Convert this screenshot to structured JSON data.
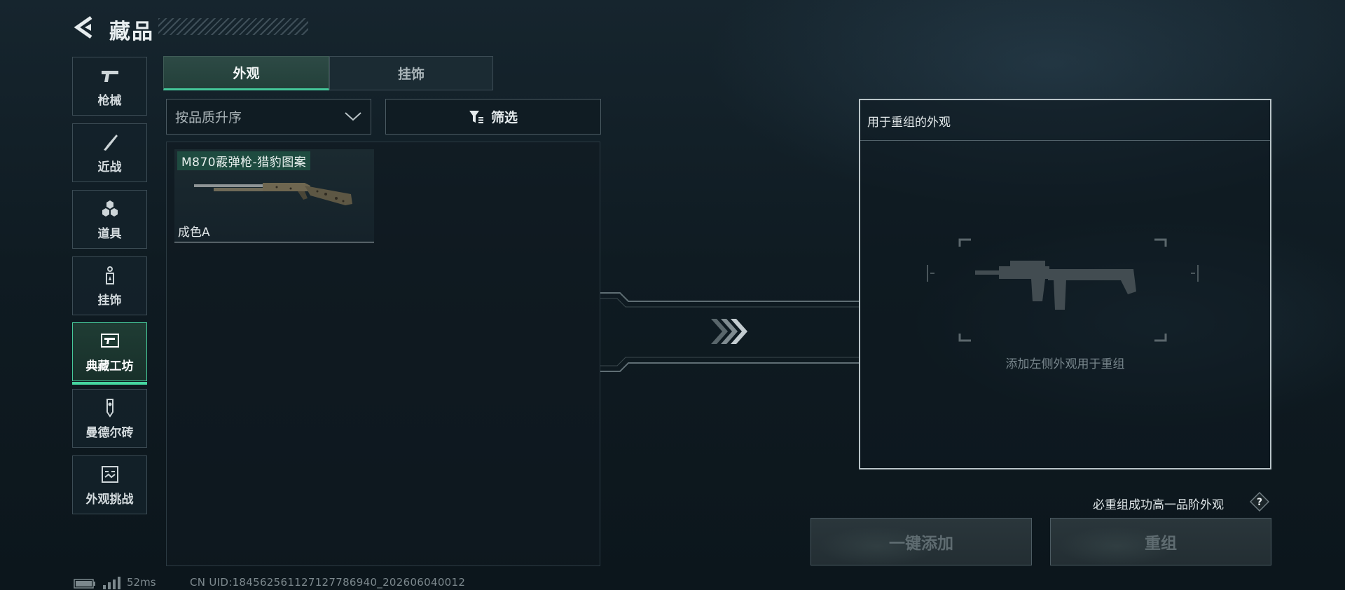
{
  "header": {
    "title": "藏品",
    "back_icon": "back-arrow-icon"
  },
  "sidebar": {
    "items": [
      {
        "label": "枪械",
        "icon": "pistol-icon",
        "active": false
      },
      {
        "label": "近战",
        "icon": "knife-icon",
        "active": false
      },
      {
        "label": "道具",
        "icon": "grenade-cluster-icon",
        "active": false
      },
      {
        "label": "挂饰",
        "icon": "charm-tag-icon",
        "active": false
      },
      {
        "label": "典藏工坊",
        "icon": "workshop-gun-icon",
        "active": true
      },
      {
        "label": "曼德尔砖",
        "icon": "mandel-brick-icon",
        "active": false
      },
      {
        "label": "外观挑战",
        "icon": "challenge-icon",
        "active": false
      }
    ]
  },
  "tabs": [
    {
      "label": "外观",
      "selected": true
    },
    {
      "label": "挂饰",
      "selected": false
    }
  ],
  "sort": {
    "value": "按品质升序"
  },
  "filter": {
    "label": "筛选"
  },
  "items": [
    {
      "name": "M870霰弹枪-猎豹图案",
      "grade": "成色A"
    }
  ],
  "reform_panel": {
    "title": "用于重组的外观",
    "placeholder": "添加左侧外观用于重组"
  },
  "guarantee": {
    "text": "必重组成功高一品阶外观",
    "help": "?"
  },
  "buttons": {
    "one_click_add": "一键添加",
    "reform": "重组"
  },
  "status": {
    "ping": "52ms",
    "uid": "CN UID:1845625611271277869​40_202606040012"
  },
  "colors": {
    "accent": "#44c799",
    "active_bg": "#1f3c34",
    "panel_border": "#b9c4c8",
    "disabled_text": "#5f6c71"
  }
}
